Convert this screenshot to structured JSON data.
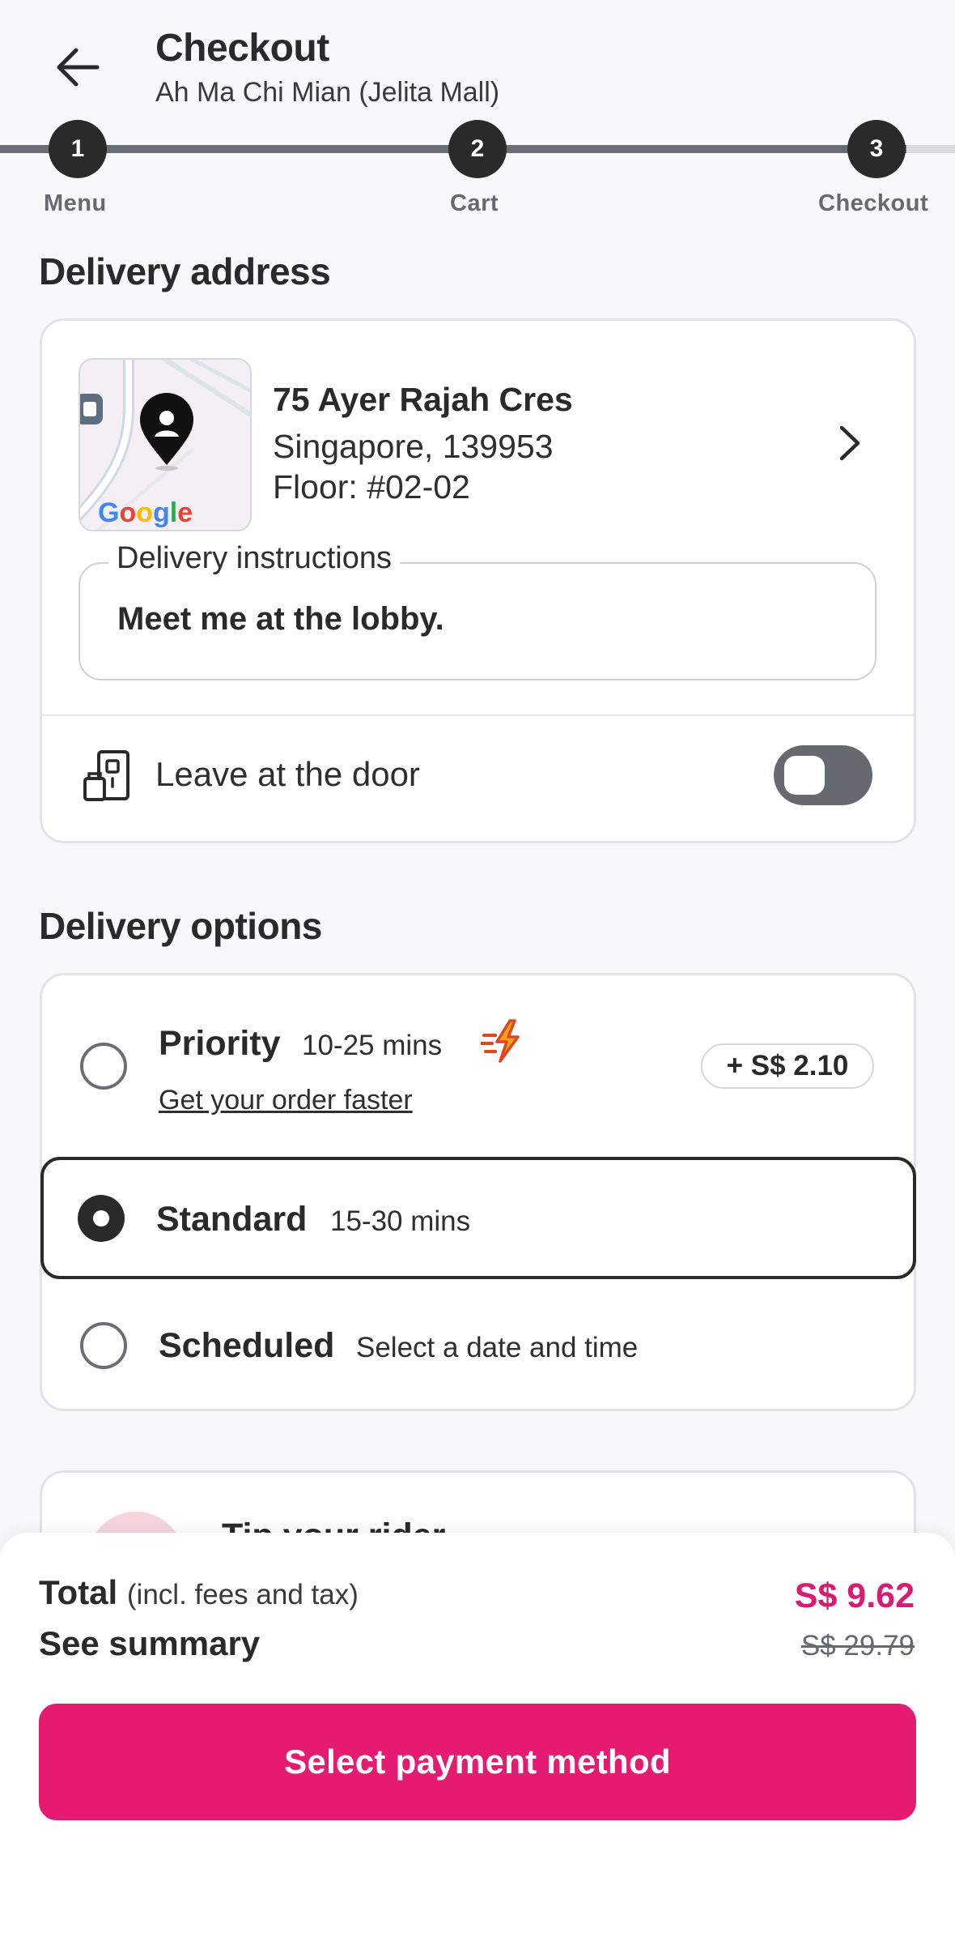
{
  "header": {
    "title": "Checkout",
    "subtitle": "Ah Ma Chi Mian (Jelita Mall)"
  },
  "stepper": {
    "steps": [
      {
        "number": "1",
        "label": "Menu"
      },
      {
        "number": "2",
        "label": "Cart"
      },
      {
        "number": "3",
        "label": "Checkout"
      }
    ]
  },
  "delivery_address": {
    "section_title": "Delivery address",
    "line1": "75 Ayer Rajah Cres",
    "line2": "Singapore, 139953",
    "line3": "Floor: #02-02",
    "map_logo": "Google",
    "instructions_label": "Delivery instructions",
    "instructions_value": "Meet me at the lobby.",
    "leave_at_door_label": "Leave at the door",
    "leave_at_door_enabled": false
  },
  "delivery_options": {
    "section_title": "Delivery options",
    "options": [
      {
        "name": "Priority",
        "detail": "10-25 mins",
        "link": "Get your order faster",
        "price": "+ S$ 2.10",
        "selected": false
      },
      {
        "name": "Standard",
        "detail": "15-30 mins",
        "selected": true
      },
      {
        "name": "Scheduled",
        "detail": "Select a date and time",
        "selected": false
      }
    ]
  },
  "next_card": {
    "partial_title": "Tip your rider"
  },
  "footer": {
    "total_label": "Total",
    "total_sub": "(incl. fees and tax)",
    "see_summary": "See summary",
    "total_price": "S$ 9.62",
    "old_price": "S$ 29.79",
    "pay_button": "Select payment method"
  },
  "colors": {
    "accent": "#e51b72",
    "price_pink": "#d81b73",
    "dark": "#2a2a2a",
    "background": "#f7f8fa"
  }
}
